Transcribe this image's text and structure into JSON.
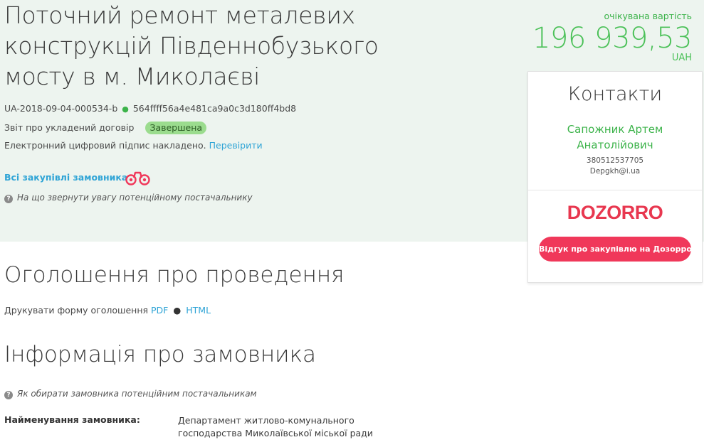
{
  "tender": {
    "title": "Поточний ремонт металевих конструкцій Південнобузького мосту в м. Миколаєві",
    "id": "UA-2018-09-04-000534-b",
    "hash": "564ffff56a4e481ca9a0c3d180ff4bd8",
    "report_label": "Звіт про укладений договір",
    "status": "Завершена",
    "signature_text": "Електронний цифровий підпис накладено.",
    "signature_link": "Перевірити",
    "all_purchases_link": "Всі закупівлі замовника",
    "hint_supplier": "На що звернути увагу потенційному постачальнику"
  },
  "price": {
    "label": "очікувана вартість",
    "value": "196 939,53",
    "currency": "UAH"
  },
  "contacts": {
    "title": "Контакти",
    "name": "Сапожник Артем Анатолійович",
    "phone": "380512537705",
    "email": "Depgkh@i.ua",
    "dozorro_logo": "DOZORRO",
    "dozorro_button": "Відгук про закупівлю на Дозорро"
  },
  "announcement": {
    "title": "Оголошення про проведення",
    "print_label": "Друкувати форму оголошення",
    "pdf_link": "PDF",
    "html_link": "HTML"
  },
  "customer": {
    "title": "Інформація про замовника",
    "hint": "Як обирати замовника потенційним постачальникам",
    "name_label": "Найменування замовника:",
    "name_value": "Департамент житлово-комунального господарства Миколаївської міської ради"
  },
  "colors": {
    "hero_bg": "#edf4ef",
    "accent_green": "#4cc159",
    "link_blue": "#2fa4d6",
    "dozorro_red": "#f0385a",
    "badge_green": "#9bdc8e"
  }
}
